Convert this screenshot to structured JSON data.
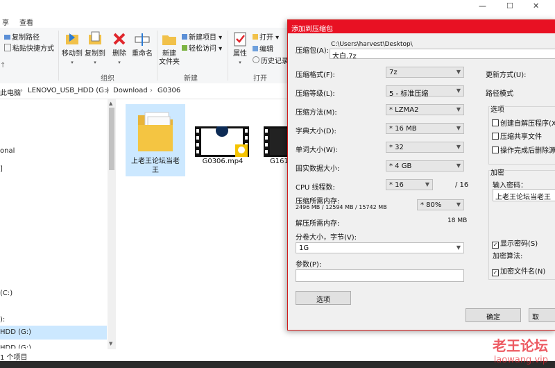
{
  "explorer": {
    "ribbon_tabs": [
      "享",
      "查看"
    ],
    "window_controls": [
      "—",
      "☐",
      "✕"
    ],
    "ribbon": {
      "copy_path": "复制路径",
      "paste_shortcut": "粘贴快捷方式",
      "move_to": "移动到",
      "copy_to": "复制到",
      "delete": "删除",
      "rename": "重命名",
      "new_folder": "新建\n文件夹",
      "new_item": "新建项目 ▾",
      "easy_access": "轻松访问 ▾",
      "properties": "属性",
      "open": "打开 ▾",
      "edit": "编辑",
      "history": "历史记录",
      "group_organize": "组织",
      "group_new": "新建",
      "group_open": "打开"
    },
    "breadcrumb": [
      "此电脑",
      "LENOVO_USB_HDD (G:)",
      "Download",
      "G0306"
    ],
    "nav_items": [
      "onal",
      "]",
      "(C:)",
      "):",
      "HDD (G:)",
      "HDD (G:)"
    ],
    "files": [
      {
        "name": "上老王论坛当老王"
      },
      {
        "name": "G0306.mp4"
      },
      {
        "name": "G161"
      }
    ],
    "status": "1 个项目"
  },
  "dialog": {
    "title": "添加到压缩包",
    "archive_label": "压缩包(A):",
    "archive_path": "C:\\Users\\harvest\\Desktop\\",
    "archive_name": "大白.7z",
    "update_mode_label": "更新方式(U):",
    "path_mode_label": "路径模式",
    "rows": [
      {
        "label": "压缩格式(F):",
        "value": "7z"
      },
      {
        "label": "压缩等级(L):",
        "value": "5 - 标准压缩"
      },
      {
        "label": "压缩方法(M):",
        "value": "* LZMA2"
      },
      {
        "label": "字典大小(D):",
        "value": "* 16 MB"
      },
      {
        "label": "单词大小(W):",
        "value": "* 32"
      },
      {
        "label": "固实数据大小:",
        "value": "* 4 GB"
      }
    ],
    "cpu_threads_label": "CPU 线程数:",
    "cpu_threads_value": "* 16",
    "cpu_threads_max": "/ 16",
    "mem_compress_label": "压缩所需内存:",
    "mem_compress_detail": "2496 MB / 12594 MB / 15742 MB",
    "mem_compress_percent": "* 80%",
    "mem_decompress_label": "解压所需内存:",
    "mem_decompress_value": "18 MB",
    "volume_label": "分卷大小，字节(V):",
    "volume_value": "1G",
    "params_label": "参数(P):",
    "params_value": "",
    "options_button": "选项",
    "options_group": "选项",
    "opt_sfx": "创建自解压程序(X)",
    "opt_shared": "压缩共享文件",
    "opt_delete": "操作完成后删除源文",
    "encrypt_group": "加密",
    "password_label": "输入密码：",
    "password_value": "上老王论坛当老王",
    "show_password": "显示密码(S)",
    "encrypt_method_label": "加密算法:",
    "encrypt_names": "加密文件名(N)",
    "ok_button": "确定",
    "cancel_button": "取"
  },
  "watermark": {
    "line1": "老王论坛",
    "line2": "laowang.vip"
  },
  "colors": {
    "title_bar": "#e81123",
    "selection": "#cce8ff",
    "folder": "#f4c542"
  }
}
